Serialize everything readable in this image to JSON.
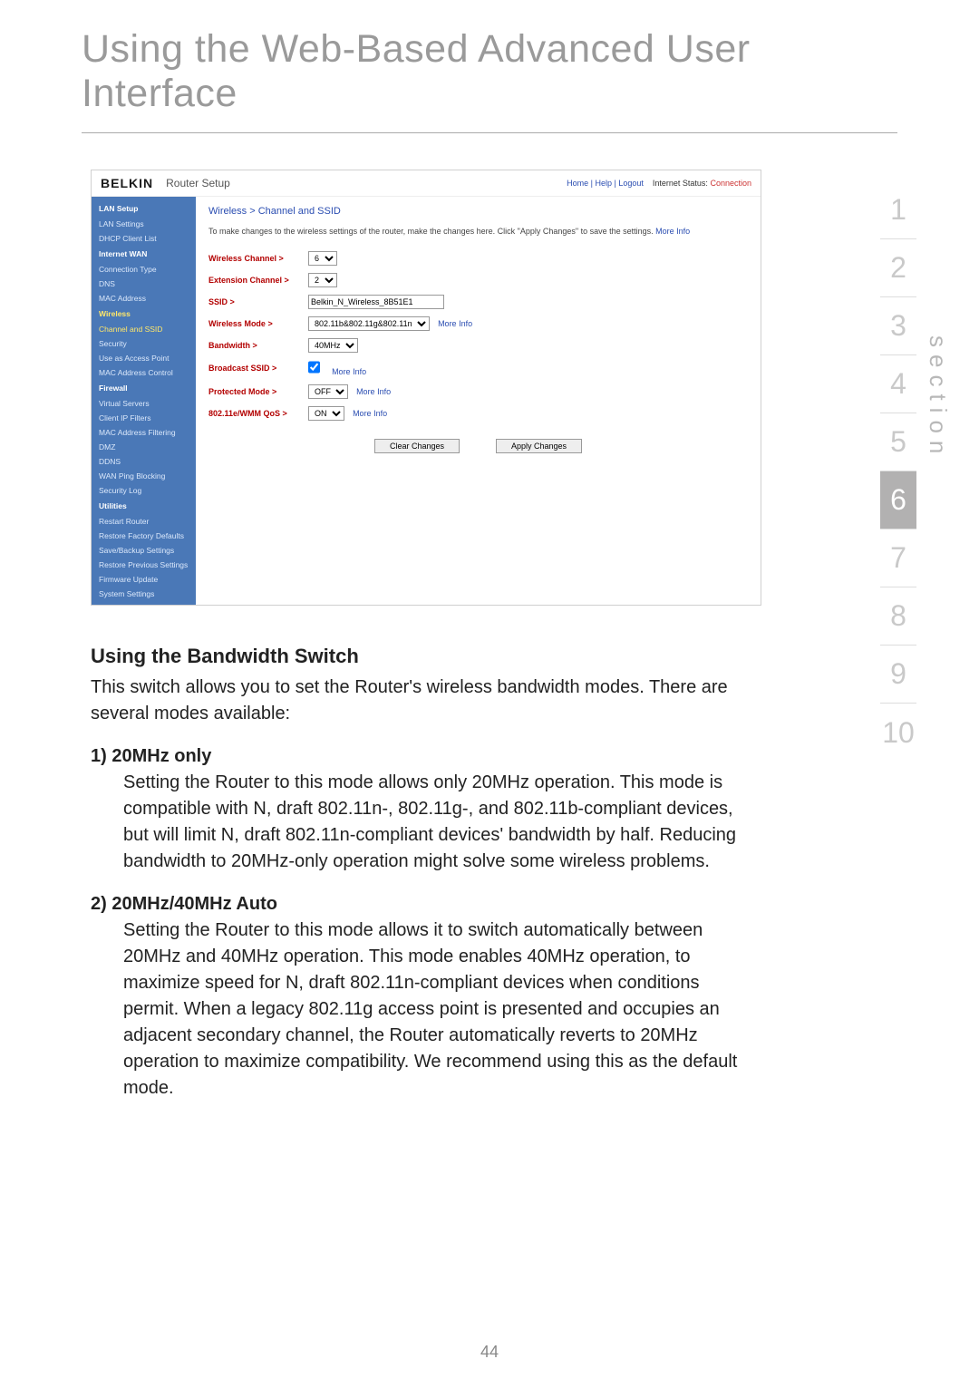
{
  "page": {
    "heading": "Using the Web-Based Advanced User Interface",
    "page_number": "44"
  },
  "section_index": {
    "label": "section",
    "active": 6,
    "items": [
      "1",
      "2",
      "3",
      "4",
      "5",
      "6",
      "7",
      "8",
      "9",
      "10"
    ]
  },
  "router_ui": {
    "logo": "BELKIN",
    "title": "Router Setup",
    "toplinks": {
      "home": "Home",
      "help": "Help",
      "logout": "Logout",
      "status_label": "Internet Status:",
      "status_value": "Connection"
    },
    "nav": {
      "lan_setup": "LAN Setup",
      "lan_settings": "LAN Settings",
      "dhcp_client_list": "DHCP Client List",
      "internet_wan": "Internet WAN",
      "connection_type": "Connection Type",
      "dns": "DNS",
      "mac_address": "MAC Address",
      "wireless": "Wireless",
      "channel_ssid": "Channel and SSID",
      "security": "Security",
      "use_as_ap": "Use as Access Point",
      "mac_addr_ctrl": "MAC Address Control",
      "firewall": "Firewall",
      "virtual_servers": "Virtual Servers",
      "client_ip_filters": "Client IP Filters",
      "mac_addr_filtering": "MAC Address Filtering",
      "dmz": "DMZ",
      "ddns": "DDNS",
      "wan_ping_blocking": "WAN Ping Blocking",
      "security_log": "Security Log",
      "utilities": "Utilities",
      "restart_router": "Restart Router",
      "restore_defaults": "Restore Factory Defaults",
      "save_backup": "Save/Backup Settings",
      "restore_prev": "Restore Previous Settings",
      "firmware_update": "Firmware Update",
      "system_settings": "System Settings"
    },
    "main": {
      "breadcrumb": "Wireless > Channel and SSID",
      "description_a": "To make changes to the wireless settings of the router, make the changes here. Click \"Apply Changes\" to save the settings. ",
      "description_more": "More Info",
      "rows": {
        "wireless_channel": {
          "label": "Wireless Channel >",
          "value": "6"
        },
        "extension_channel": {
          "label": "Extension Channel >",
          "value": "2"
        },
        "ssid": {
          "label": "SSID >",
          "value": "Belkin_N_Wireless_8B51E1"
        },
        "wireless_mode": {
          "label": "Wireless Mode >",
          "value": "802.11b&802.11g&802.11n",
          "more": "More Info"
        },
        "bandwidth": {
          "label": "Bandwidth >",
          "value": "40MHz"
        },
        "broadcast_ssid": {
          "label": "Broadcast SSID >",
          "checked": true,
          "more": "More Info"
        },
        "protected_mode": {
          "label": "Protected Mode >",
          "value": "OFF",
          "more": "More Info"
        },
        "wmm_qos": {
          "label": "802.11e/WMM QoS >",
          "value": "ON",
          "more": "More Info"
        }
      },
      "buttons": {
        "clear": "Clear Changes",
        "apply": "Apply Changes"
      }
    }
  },
  "doc": {
    "h_bandwidth": "Using the Bandwidth Switch",
    "p_bandwidth": "This switch allows you to set the Router's wireless bandwidth modes. There are several modes available:",
    "mode1_h": "1)  20MHz only",
    "mode1_body": "Setting the Router to this mode allows only 20MHz operation. This mode is compatible with N, draft 802.11n-, 802.11g-, and 802.11b-compliant devices, but will limit N, draft 802.11n-compliant devices' bandwidth by half. Reducing bandwidth to 20MHz-only operation might solve some wireless problems.",
    "mode2_h": "2)  20MHz/40MHz Auto",
    "mode2_body": "Setting the Router to this mode allows it to switch automatically between 20MHz and 40MHz operation. This mode enables 40MHz operation, to maximize speed for N, draft 802.11n-compliant devices when conditions permit. When a legacy 802.11g access point is presented and occupies an adjacent secondary channel, the Router automatically reverts to 20MHz operation to maximize compatibility. We recommend using this as the default mode."
  }
}
